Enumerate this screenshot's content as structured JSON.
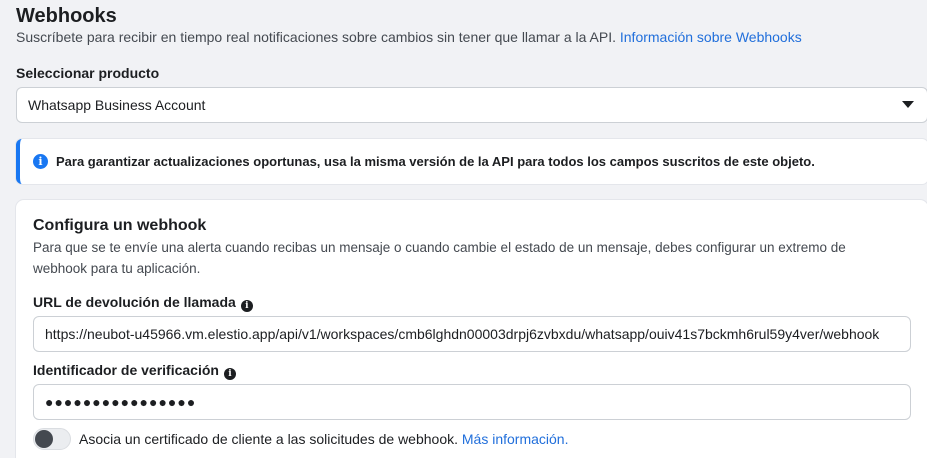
{
  "header": {
    "title": "Webhooks",
    "subtitle": "Suscríbete para recibir en tiempo real notificaciones sobre cambios sin tener que llamar a la API.",
    "subtitle_link": "Información sobre Webhooks"
  },
  "product": {
    "label": "Seleccionar producto",
    "selected": "Whatsapp Business Account"
  },
  "banner": {
    "text": "Para garantizar actualizaciones oportunas, usa la misma versión de la API para todos los campos suscritos de este objeto."
  },
  "webhook": {
    "title": "Configura un webhook",
    "description": "Para que se te envíe una alerta cuando recibas un mensaje o cuando cambie el estado de un mensaje, debes configurar un extremo de webhook para tu aplicación.",
    "callback_label": "URL de devolución de llamada",
    "callback_value": "https://neubot-u45966.vm.elestio.app/api/v1/workspaces/cmb6lghdn00003drpj6zvbxdu/whatsapp/ouiv41s7bckmh6rul59y4ver/webhook",
    "verify_label": "Identificador de verificación",
    "verify_value": "●●●●●●●●●●●●●●●●",
    "cert_text": "Asocia un certificado de cliente a las solicitudes de webhook.",
    "cert_link": "Más información."
  },
  "colors": {
    "accent": "#1877f2",
    "link": "#216fdb"
  }
}
